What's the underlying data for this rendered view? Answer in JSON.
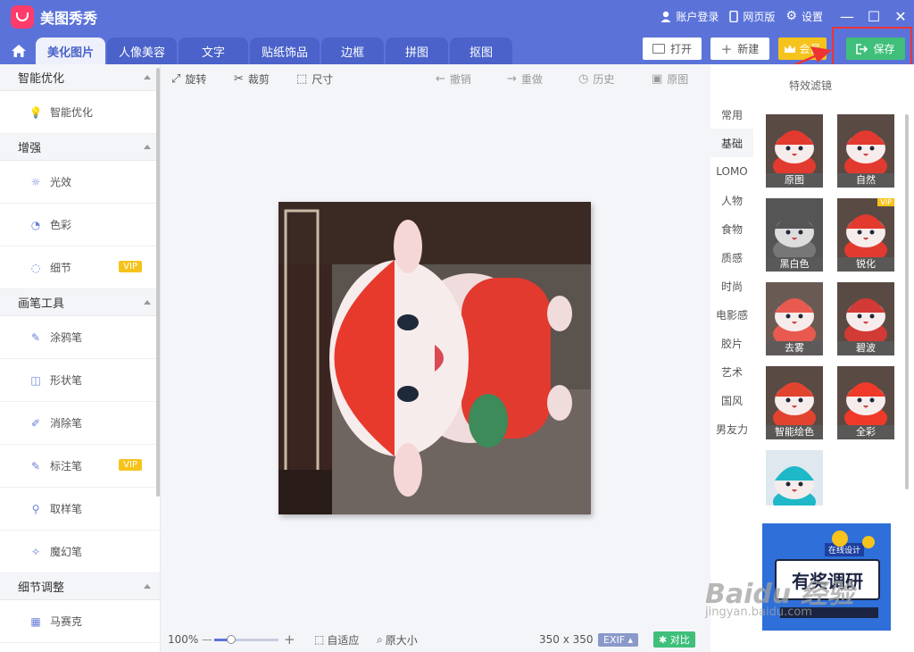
{
  "header": {
    "app_title": "美图秀秀",
    "account_login": "账户登录",
    "web_version": "网页版",
    "settings": "设置"
  },
  "tabs": [
    "美化图片",
    "人像美容",
    "文字",
    "贴纸饰品",
    "边框",
    "拼图",
    "抠图"
  ],
  "actions": {
    "open": "打开",
    "new": "新建",
    "vip": "会员",
    "save": "保存"
  },
  "sidebar": {
    "sections": [
      {
        "title": "智能优化",
        "items": [
          {
            "label": "智能优化",
            "icon": "bulb-icon",
            "vip": ""
          }
        ]
      },
      {
        "title": "增强",
        "items": [
          {
            "label": "光效",
            "icon": "sun-icon",
            "vip": ""
          },
          {
            "label": "色彩",
            "icon": "palette-icon",
            "vip": ""
          },
          {
            "label": "细节",
            "icon": "detail-icon",
            "vip": "VIP"
          }
        ]
      },
      {
        "title": "画笔工具",
        "items": [
          {
            "label": "涂鸦笔",
            "icon": "doodle-pen-icon",
            "vip": ""
          },
          {
            "label": "形状笔",
            "icon": "shape-pen-icon",
            "vip": ""
          },
          {
            "label": "消除笔",
            "icon": "eraser-pen-icon",
            "vip": ""
          },
          {
            "label": "标注笔",
            "icon": "mark-pen-icon",
            "vip": "VIP"
          },
          {
            "label": "取样笔",
            "icon": "dropper-icon",
            "vip": ""
          },
          {
            "label": "魔幻笔",
            "icon": "magic-pen-icon",
            "vip": ""
          }
        ]
      },
      {
        "title": "细节调整",
        "items": [
          {
            "label": "马赛克",
            "icon": "mosaic-icon",
            "vip": ""
          }
        ]
      }
    ]
  },
  "edit_toolbar": {
    "rotate": "旋转",
    "crop": "裁剪",
    "size": "尺寸",
    "undo": "撤销",
    "redo": "重做",
    "history": "历史",
    "original": "原图"
  },
  "bottom_bar": {
    "zoom": "100%",
    "fit": "自适应",
    "actual_size": "原大小",
    "dimensions": "350 x 350",
    "exif": "EXIF",
    "compare": "对比"
  },
  "filters": {
    "title": "特效滤镜",
    "categories": [
      "常用",
      "基础",
      "LOMO",
      "人物",
      "食物",
      "质感",
      "时尚",
      "电影感",
      "胶片",
      "艺术",
      "国风",
      "男友力"
    ],
    "active_category": "基础",
    "items": [
      {
        "label": "原图",
        "vip": ""
      },
      {
        "label": "自然",
        "vip": ""
      },
      {
        "label": "黑白色",
        "vip": ""
      },
      {
        "label": "锐化",
        "vip": "VIP"
      },
      {
        "label": "去雾",
        "vip": ""
      },
      {
        "label": "碧波",
        "vip": ""
      },
      {
        "label": "智能绘色",
        "vip": ""
      },
      {
        "label": "全彩",
        "vip": ""
      },
      {
        "label": "",
        "vip": ""
      }
    ]
  },
  "ad": {
    "badge": "在线设计",
    "text": "有奖调研"
  },
  "watermark": {
    "brand": "Baidu 经验",
    "url": "jingyan.baidu.com"
  },
  "colors": {
    "header": "#5b73d9",
    "save": "#3fbf7a",
    "vip": "#f6c31c",
    "highlight": "#e33"
  }
}
